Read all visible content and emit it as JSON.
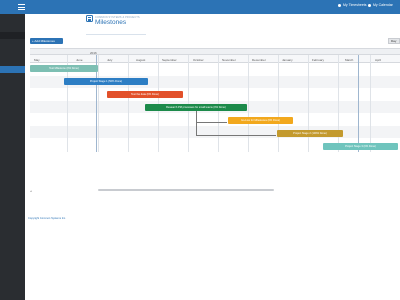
{
  "topbar": {
    "nav1_label": "My Timesheets",
    "nav2_label": "My Calendar"
  },
  "brand": {
    "small_text": "COMMON SYSTEMS & PROJECTS",
    "title": "Milestones"
  },
  "toolbar": {
    "add_button_label": "+ Add Milestones",
    "view_button_label": "Day"
  },
  "timeline": {
    "year": "2016",
    "months": [
      "May",
      "June",
      "July",
      "August",
      "September",
      "October",
      "November",
      "December",
      "January",
      "February",
      "March",
      "April"
    ]
  },
  "tasks": [
    {
      "label": "Test Milestone (0% Done)",
      "color": "#7dbfb3"
    },
    {
      "label": "Project Stage 1 (50% Done)",
      "color": "#2d7ec4"
    },
    {
      "label": "Test the data (0% Done)",
      "color": "#e2502a"
    },
    {
      "label": "Research PM processes for small teams (0% Done)",
      "color": "#1c8a4a"
    },
    {
      "label": "Go-Live for Milestones (0% Done)",
      "color": "#f2a81d"
    },
    {
      "label": "Project Stage 2 (100% Done)",
      "color": "#c39a2e"
    },
    {
      "label": "Project Stage 3 (0% Done)",
      "color": "#6fc4bd"
    }
  ],
  "footer": {
    "copyright": "Copyright Common Systems Inc."
  },
  "colors": {
    "accent": "#2c73b5",
    "sidebar": "#2a2d31"
  }
}
